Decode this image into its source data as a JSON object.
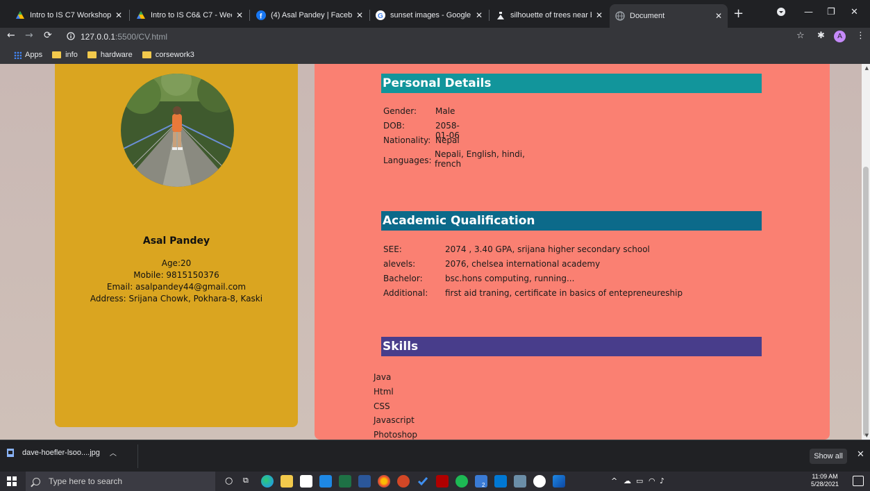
{
  "browser": {
    "tabs": [
      {
        "title": "Intro to IS C7 Workshop - W",
        "icon": "google-drive-icon"
      },
      {
        "title": "Intro to IS C6& C7 - Week 1",
        "icon": "google-drive-icon"
      },
      {
        "title": "(4) Asal Pandey | Facebook",
        "icon": "facebook-icon"
      },
      {
        "title": "sunset images - Google Sea",
        "icon": "google-icon"
      },
      {
        "title": "silhouette of trees near bod",
        "icon": "image-icon"
      },
      {
        "title": "Document",
        "icon": "globe-icon"
      }
    ],
    "url_host": "127.0.0.1",
    "url_path": ":5500/CV.html",
    "bookmarks": [
      "Apps",
      "info",
      "hardware",
      "corsework3"
    ],
    "profile_initial": "A"
  },
  "cv": {
    "name": "Asal Pandey",
    "contact": [
      "Age:20",
      "Mobile: 9815150376",
      "Email: asalpandey44@gmail.com",
      "Address: Srijana Chowk, Pokhara-8, Kaski"
    ],
    "personal": {
      "heading": "Personal Details",
      "gender_label": "Gender:",
      "gender": "Male",
      "dob_label": "DOB:",
      "dob": "2058-01-06",
      "nationality_label": "Nationality:",
      "nationality": "Nepal",
      "languages_label": "Languages:",
      "languages_line1": "Nepali, English, hindi,",
      "languages_line2": "french"
    },
    "academic": {
      "heading": "Academic Qualification",
      "see_label": "SEE:",
      "see": "2074 , 3.40 GPA, srijana higher secondary school",
      "alevels_label": "alevels:",
      "alevels": "2076, chelsea international academy",
      "bachelor_label": "Bachelor:",
      "bachelor": "bsc.hons computing, running...",
      "additional_label": "Additional:",
      "additional": "first aid traning, certificate in basics of entepreneureship"
    },
    "skills": {
      "heading": "Skills",
      "items": [
        "Java",
        "Html",
        "CSS",
        "Javascript",
        "Photoshop"
      ]
    }
  },
  "downloads": {
    "file": "dave-hoefler-lsoo....jpg",
    "show_all": "Show all"
  },
  "taskbar": {
    "search_placeholder": "Type here to search",
    "time": "11:09 AM",
    "date": "5/28/2021",
    "badge_count": "2"
  },
  "colors": {
    "left_card": "#daa520",
    "right_card": "#fa8072",
    "personal_header": "#12959b",
    "academic_header": "#0c6a8a",
    "skills_header": "#483d8b"
  }
}
